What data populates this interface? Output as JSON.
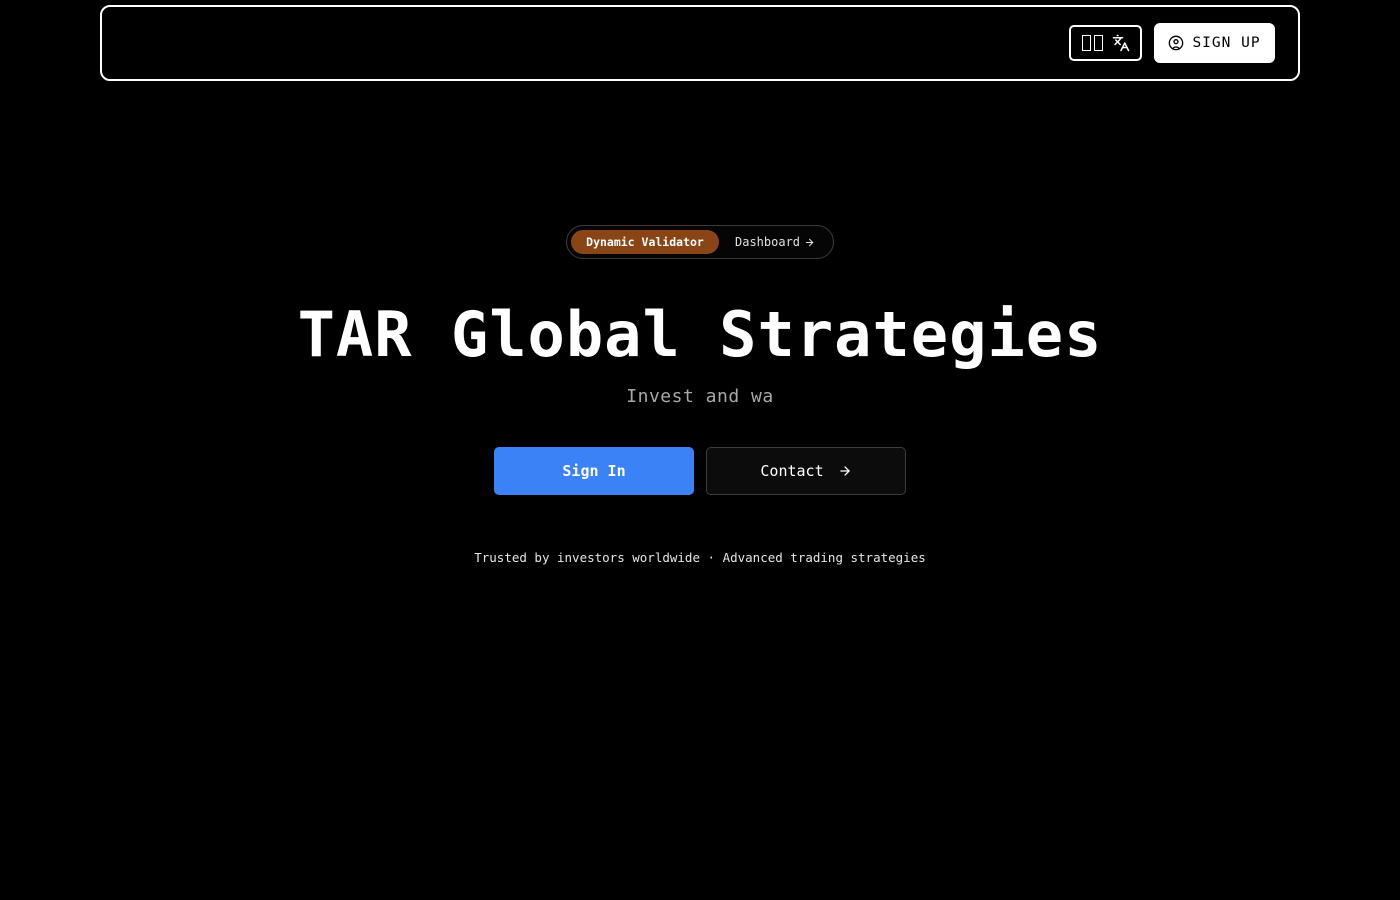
{
  "navbar": {
    "language_button": {
      "icons": [
        "flag-icon",
        "translate-icon"
      ]
    },
    "signup_label": "SIGN UP",
    "signup_icon": "user-circle-icon"
  },
  "hero": {
    "pill": {
      "badge": "Dynamic Validator",
      "link": "Dashboard",
      "link_icon": "arrow-right-icon",
      "badge_color": "#8a4517"
    },
    "title": "TAR Global Strategies",
    "subtitle": "Invest and wa",
    "buttons": {
      "signin_label": "Sign In",
      "contact_label": "Contact",
      "contact_icon": "arrow-right-icon",
      "primary_color": "#3b82f6"
    },
    "tagline": "Trusted by investors worldwide · Advanced trading strategies"
  }
}
